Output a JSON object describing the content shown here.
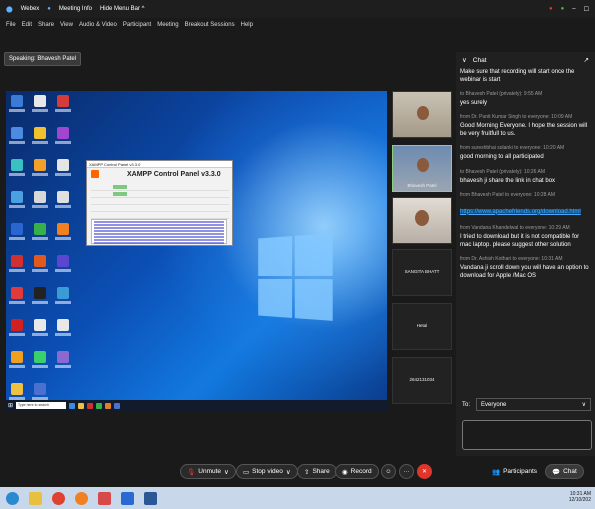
{
  "titlebar": {
    "app": "Webex",
    "meeting_info": "Meeting Info",
    "hide_menu": "Hide Menu Bar ^"
  },
  "menu": [
    "File",
    "Edit",
    "Share",
    "View",
    "Audio & Video",
    "Participant",
    "Meeting",
    "Breakout Sessions",
    "Help"
  ],
  "speaking": "Speaking: Bhavesh Patel",
  "xampp": {
    "window_title": "XAMPP Control Panel v3.3.0",
    "heading": "XAMPP Control Panel v3.3.0"
  },
  "taskbar_search": "Type here to search",
  "participants": [
    {
      "name": ""
    },
    {
      "name": "Bhavesh Patel"
    },
    {
      "name": ""
    },
    {
      "name": "SANGITA BHATT"
    },
    {
      "name": "Hetal"
    },
    {
      "name": "2642131034"
    }
  ],
  "chat": {
    "title": "Chat",
    "messages": [
      {
        "from": "",
        "text": "Make sure that recording will start once the webinar is start"
      },
      {
        "from": "to Bhavesh Patel (privately):  9:55 AM",
        "text": "yes surely"
      },
      {
        "from": "from Dr. Punit Kumar Singh to everyone:  10:09 AM",
        "text": "Good Morning Everyone. I hope the session will be very fruitfull to us."
      },
      {
        "from": "from sureshbhai solanki to everyone:  10:20 AM",
        "text": "good morning to all participated"
      },
      {
        "from": "to Bhavesh Patel (privately):  10:26 AM",
        "text": "bhavesh ji share the link in chat box"
      },
      {
        "from": "from Bhavesh Patel to everyone:  10:28 AM",
        "link": "https://www.apachefriends.org/download.html"
      },
      {
        "from": "from Vandana Khandelwal to everyone:  10:29 AM",
        "text": "I tried to download but it is not compatible for mac laptop. please suggest other solution"
      },
      {
        "from": "from Dr. Ashish Kothari to everyone:  10:31 AM",
        "text": "Vandana ji scroll down you will have an option to download for Apple /Mac OS"
      }
    ],
    "to_label": "To:",
    "to_value": "Everyone"
  },
  "controls": {
    "unmute": "Unmute",
    "stop_video": "Stop video",
    "share": "Share",
    "record": "Record",
    "participants": "Participants",
    "chat": "Chat"
  },
  "tray": {
    "time": "10:31 AM",
    "date": "12/10/202"
  }
}
